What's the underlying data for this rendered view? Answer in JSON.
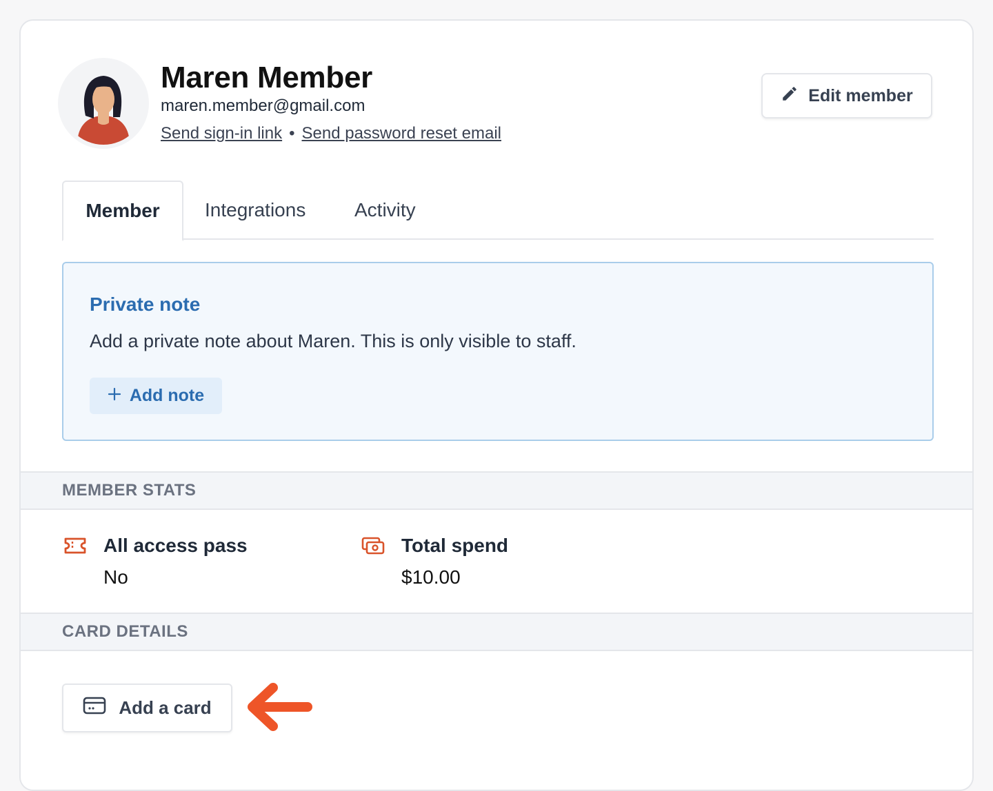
{
  "profile": {
    "name": "Maren Member",
    "email": "maren.member@gmail.com",
    "send_signin_link": "Send sign-in link",
    "separator": "•",
    "send_password_reset": "Send password reset email",
    "edit_button": "Edit member"
  },
  "tabs": [
    {
      "label": "Member",
      "active": true
    },
    {
      "label": "Integrations",
      "active": false
    },
    {
      "label": "Activity",
      "active": false
    }
  ],
  "private_note": {
    "title": "Private note",
    "description": "Add a private note about Maren. This is only visible to staff.",
    "add_button": "Add note"
  },
  "member_stats": {
    "header": "MEMBER STATS",
    "items": [
      {
        "label": "All access pass",
        "value": "No",
        "icon": "ticket-icon"
      },
      {
        "label": "Total spend",
        "value": "$10.00",
        "icon": "money-icon"
      }
    ]
  },
  "card_details": {
    "header": "CARD DETAILS",
    "add_button": "Add a card"
  },
  "colors": {
    "accent_blue": "#2b6cb0",
    "icon_orange": "#d9532a",
    "arrow_orange": "#ee5528"
  }
}
